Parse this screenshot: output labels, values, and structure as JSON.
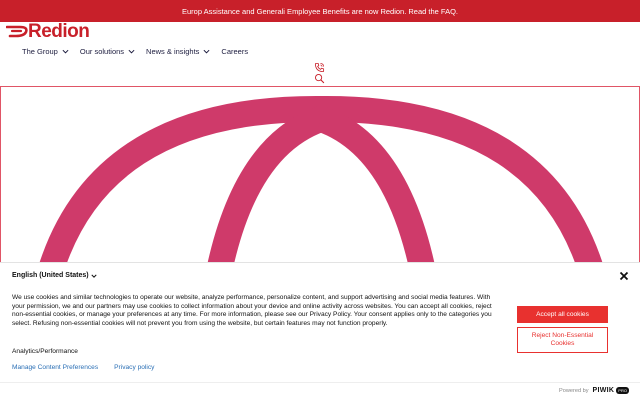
{
  "announcement": {
    "text": "Europ Assistance and Generali Employee Benefits are now Redion. Read the FAQ."
  },
  "brand": {
    "name": "Redion",
    "color": "#c8202a"
  },
  "nav": {
    "items": [
      {
        "label": "The Group",
        "has_dropdown": true
      },
      {
        "label": "Our solutions",
        "has_dropdown": true
      },
      {
        "label": "News & insights",
        "has_dropdown": true
      },
      {
        "label": "Careers",
        "has_dropdown": false
      }
    ]
  },
  "header_icons": [
    "phone-icon",
    "search-icon"
  ],
  "hero": {
    "graphic": "pink-arches",
    "color": "#cf3a6a"
  },
  "cookie_banner": {
    "language": "English (United States)",
    "body": "We use cookies and similar technologies to operate our website, analyze performance, personalize content, and support advertising and social media features. With your permission, we and our partners may use cookies to collect information about your device and online activity across websites. You can accept all cookies, reject non-essential cookies, or manage your preferences at any time. For more information, please see our Privacy Policy. Your consent applies only to the categories you select. Refusing non-essential cookies will not prevent you from using the website, but certain features may not function properly.",
    "category": "Analytics/Performance",
    "links": {
      "manage": "Manage Content Preferences",
      "privacy": "Privacy policy"
    },
    "buttons": {
      "accept": "Accept all cookies",
      "reject": "Reject Non-Essential Cookies"
    },
    "accent_color": "#e8312f"
  },
  "footer": {
    "powered_by": "Powered by",
    "vendor": "PIWIK",
    "badge": "PRO"
  }
}
